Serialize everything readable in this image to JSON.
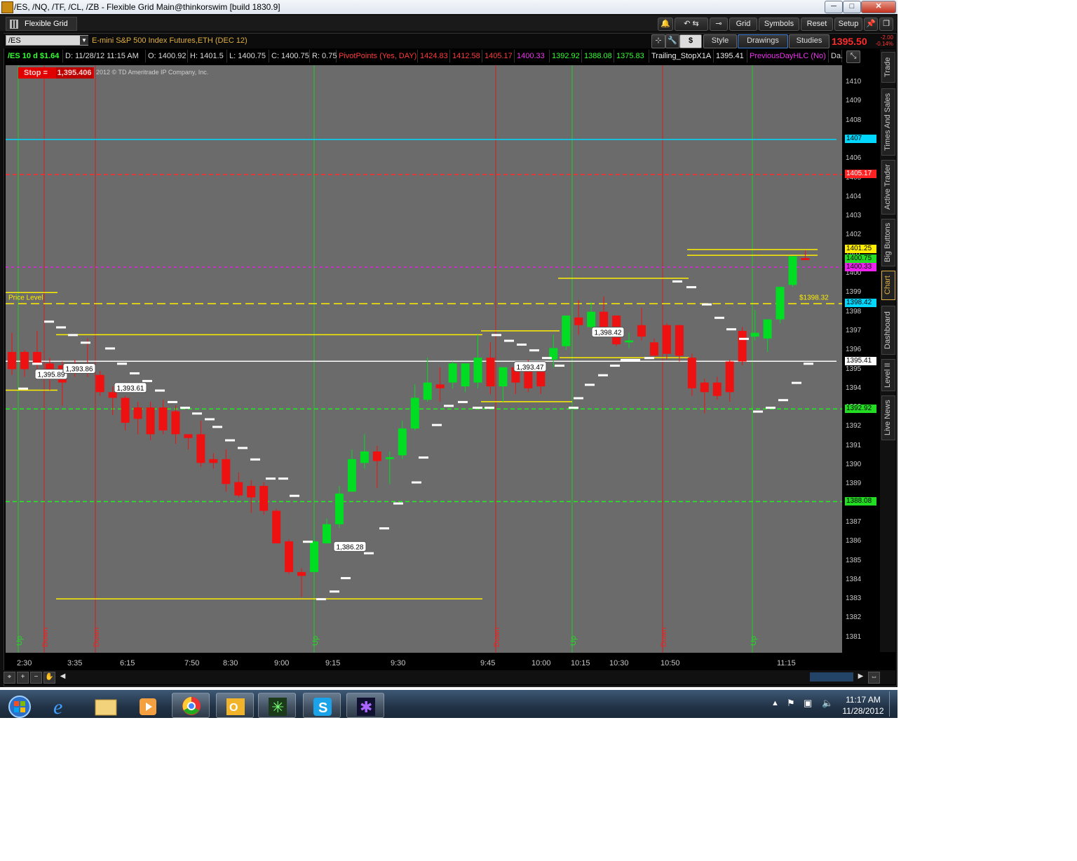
{
  "window": {
    "title": "/ES, /NQ, /TF, /CL, /ZB - Flexible Grid Main@thinkorswim [build 1830.9]"
  },
  "toolbar": {
    "tab_label": "Flexible Grid",
    "grid": "Grid",
    "symbols": "Symbols",
    "reset": "Reset",
    "setup": "Setup"
  },
  "chart_header": {
    "symbol": "/ES",
    "description": "E-mini S&P 500 Index Futures,ETH (DEC 12)",
    "style": "Style",
    "drawings": "Drawings",
    "studies": "Studies",
    "dollar": "$",
    "last": "1395.50",
    "change": "-2.00",
    "change_pct": "-0.14%"
  },
  "info_bar": {
    "agg": "/ES 10 d $1.64",
    "date": "D: 11/28/12 11:15 AM",
    "open": "O: 1400.92",
    "high": "H: 1401.5",
    "low": "L: 1400.75",
    "close": "C: 1400.75",
    "range": "R: 0.75",
    "pivot_label": "PivotPoints (Yes, DAY)",
    "pivots": [
      "1424.83",
      "1412.58",
      "1405.17",
      "1400.33",
      "1392.92",
      "1388.08",
      "1375.83"
    ],
    "trail_label": "Trailing_StopX1A",
    "trail_val": "1395.41",
    "prev_label": "PreviousDayHLC (No)",
    "extra": "Da..."
  },
  "stop": {
    "label": "Stop =",
    "value": "1,395.406"
  },
  "copyright": "2012 © TD Ameritrade IP Company, Inc.",
  "sidetabs": [
    "Trade",
    "Times And Sales",
    "Active Trader",
    "Big Buttons",
    "Chart",
    "Dashboard",
    "Level II",
    "Live News"
  ],
  "price_level_label": "Price Level",
  "price_right_label": "$1398.32",
  "callouts": [
    "1,395.89",
    "1,393.86",
    "1,393.61",
    "1,386.28",
    "1,393.47",
    "1,398.42"
  ],
  "signals": [
    "Up",
    "Down",
    "Down",
    "Up",
    "Down",
    "Up",
    "Down",
    "Up"
  ],
  "yaxis_tags": {
    "t1407": "1407",
    "t1405": "1405.17",
    "t1401": "1401.25",
    "t1400a": "1400.75",
    "t1400b": "1400.33",
    "t1398": "1398.42",
    "t1395": "1395.41",
    "t1392": "1392.92",
    "t1388": "1388.08"
  },
  "colors": {
    "plot_bg": "#6b6b6b",
    "up": "#00dd22",
    "down": "#ee1111",
    "pivot_r": "#ff2a2a",
    "pivot_s": "#22ee22",
    "prev": "#dd22dd",
    "price_level": "#ffee00"
  },
  "taskbar": {
    "time": "11:17 AM",
    "date": "11/28/2012"
  },
  "chart_data": {
    "type": "candlestick",
    "ylim": [
      1380.5,
      1410.6
    ],
    "yticks": [
      1410,
      1409,
      1408,
      1407,
      1406,
      1405,
      1404,
      1403,
      1402,
      1401,
      1400,
      1399,
      1398,
      1397,
      1396,
      1395,
      1394,
      1393,
      1392,
      1391,
      1390,
      1389,
      1388,
      1387,
      1386,
      1385,
      1384,
      1383,
      1382,
      1381
    ],
    "x_labels": [
      "2:30",
      "3:35",
      "6:15",
      "7:50",
      "8:30",
      "9:00",
      "9:15",
      "9:30",
      "9:45",
      "10:00",
      "10:15",
      "10:30",
      "10:50",
      "11:15"
    ],
    "candles": [
      [
        1395.9,
        1396.9,
        1394.7,
        1395.0
      ],
      [
        1395.9,
        1396.0,
        1394.6,
        1395.0
      ],
      [
        1395.9,
        1397.0,
        1394.8,
        1395.3
      ],
      [
        1395.3,
        1395.6,
        1393.9,
        1394.7
      ],
      [
        1395.2,
        1395.4,
        1393.1,
        1394.3
      ],
      [
        1395.3,
        1395.5,
        1394.6,
        1395.0
      ],
      [
        1395.3,
        1396.6,
        1394.6,
        1394.9
      ],
      [
        1394.7,
        1394.9,
        1393.6,
        1393.8
      ],
      [
        1393.8,
        1394.1,
        1392.6,
        1393.5
      ],
      [
        1393.5,
        1393.6,
        1391.8,
        1392.2
      ],
      [
        1393.0,
        1393.3,
        1391.6,
        1392.4
      ],
      [
        1393.0,
        1393.3,
        1391.3,
        1391.6
      ],
      [
        1393.0,
        1393.4,
        1391.6,
        1391.8
      ],
      [
        1392.8,
        1393.1,
        1391.1,
        1391.6
      ],
      [
        1391.6,
        1391.6,
        1390.8,
        1391.4
      ],
      [
        1391.6,
        1392.3,
        1389.9,
        1390.1
      ],
      [
        1390.3,
        1390.6,
        1389.8,
        1390.1
      ],
      [
        1390.3,
        1390.8,
        1388.6,
        1389.0
      ],
      [
        1389.1,
        1389.6,
        1388.3,
        1388.4
      ],
      [
        1388.9,
        1389.2,
        1387.5,
        1388.3
      ],
      [
        1388.9,
        1389.1,
        1387.4,
        1387.6
      ],
      [
        1387.6,
        1387.7,
        1385.9,
        1385.9
      ],
      [
        1386.0,
        1386.1,
        1384.3,
        1384.4
      ],
      [
        1384.4,
        1384.6,
        1383.1,
        1384.2
      ],
      [
        1384.4,
        1386.3,
        1384.4,
        1386.0
      ],
      [
        1385.9,
        1387.2,
        1385.9,
        1386.9
      ],
      [
        1386.9,
        1388.9,
        1386.7,
        1388.5
      ],
      [
        1388.6,
        1390.8,
        1388.6,
        1390.3
      ],
      [
        1390.1,
        1391.6,
        1389.8,
        1390.7
      ],
      [
        1390.7,
        1391.0,
        1388.8,
        1390.2
      ],
      [
        1390.3,
        1390.7,
        1389.0,
        1390.4
      ],
      [
        1390.5,
        1392.3,
        1390.3,
        1391.9
      ],
      [
        1391.9,
        1394.2,
        1391.8,
        1393.5
      ],
      [
        1393.4,
        1395.6,
        1393.3,
        1394.3
      ],
      [
        1394.2,
        1395.1,
        1393.3,
        1394.0
      ],
      [
        1394.3,
        1395.4,
        1394.0,
        1395.3
      ],
      [
        1394.1,
        1395.2,
        1393.8,
        1395.3
      ],
      [
        1394.3,
        1396.8,
        1394.0,
        1395.6
      ],
      [
        1395.6,
        1396.4,
        1393.7,
        1394.1
      ],
      [
        1394.1,
        1395.0,
        1393.3,
        1395.1
      ],
      [
        1395.1,
        1395.3,
        1393.7,
        1394.3
      ],
      [
        1395.3,
        1395.5,
        1393.8,
        1394.0
      ],
      [
        1395.3,
        1395.4,
        1393.7,
        1394.1
      ],
      [
        1395.5,
        1396.8,
        1395.1,
        1396.1
      ],
      [
        1396.2,
        1397.7,
        1396.0,
        1397.8
      ],
      [
        1397.7,
        1398.6,
        1396.8,
        1397.3
      ],
      [
        1397.2,
        1398.5,
        1397.1,
        1398.0
      ],
      [
        1398.0,
        1398.8,
        1397.4,
        1397.2
      ],
      [
        1397.8,
        1397.8,
        1396.2,
        1396.3
      ],
      [
        1396.4,
        1396.9,
        1396.1,
        1396.5
      ],
      [
        1397.3,
        1398.2,
        1396.5,
        1396.7
      ],
      [
        1396.4,
        1396.6,
        1395.7,
        1395.7
      ],
      [
        1397.3,
        1397.4,
        1395.5,
        1395.8
      ],
      [
        1397.3,
        1397.3,
        1395.4,
        1395.7
      ],
      [
        1395.6,
        1395.8,
        1393.6,
        1394.0
      ],
      [
        1394.3,
        1394.5,
        1392.7,
        1393.8
      ],
      [
        1394.3,
        1394.6,
        1393.4,
        1393.6
      ],
      [
        1395.4,
        1395.5,
        1393.3,
        1393.8
      ],
      [
        1397.0,
        1397.2,
        1395.2,
        1395.4
      ],
      [
        1396.7,
        1398.1,
        1396.5,
        1396.9
      ],
      [
        1396.6,
        1397.6,
        1395.9,
        1397.6
      ],
      [
        1397.6,
        1399.0,
        1397.4,
        1399.3
      ],
      [
        1399.4,
        1400.6,
        1399.3,
        1400.9
      ],
      [
        1400.8,
        1401.2,
        1400.7,
        1400.7
      ]
    ]
  }
}
